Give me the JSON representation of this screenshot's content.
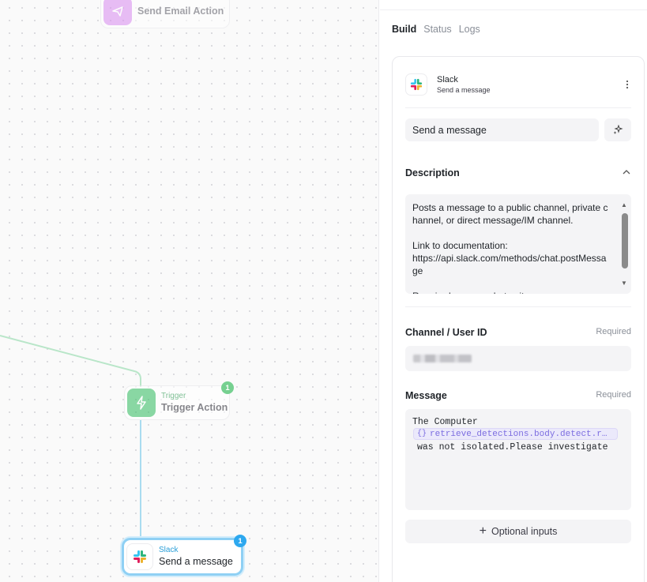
{
  "canvas": {
    "nodes": [
      {
        "sub": "",
        "title": "Send Email Action",
        "icon": "send-icon"
      },
      {
        "sub": "Trigger",
        "title": "Trigger Action",
        "icon": "bolt-icon",
        "badge": "1"
      },
      {
        "sub": "Slack",
        "title": "Send a message",
        "icon": "slack-icon",
        "badge": "1"
      }
    ]
  },
  "panel": {
    "tabs": [
      "Build",
      "Status",
      "Logs"
    ],
    "active_tab": "Build",
    "app": {
      "name": "Slack",
      "action": "Send a message"
    },
    "action_name_value": "Send a message",
    "description": {
      "label": "Description",
      "text": "Posts a message to a public channel, private channel, or direct message/IM channel.\n\nLink to documentation:\nhttps://api.slack.com/methods/chat.postMessage\n\nRequired scopes: chat:write"
    },
    "channel": {
      "label": "Channel / User ID",
      "required": "Required"
    },
    "message": {
      "label": "Message",
      "required": "Required",
      "line1": "The Computer",
      "variable": "retrieve_detections.body.detect.routing",
      "variable_icon": "{}",
      "line3": "was not isolated.Please investigate"
    },
    "optional_inputs": {
      "plus": "+",
      "label": "Optional inputs"
    }
  },
  "colors": {
    "email_node": "#d98bf0",
    "trigger_node": "#3fc06a",
    "selected_border": "#8fd0f4",
    "badge_blue": "#2da8ef",
    "variable_chip": "#7c6de0"
  }
}
